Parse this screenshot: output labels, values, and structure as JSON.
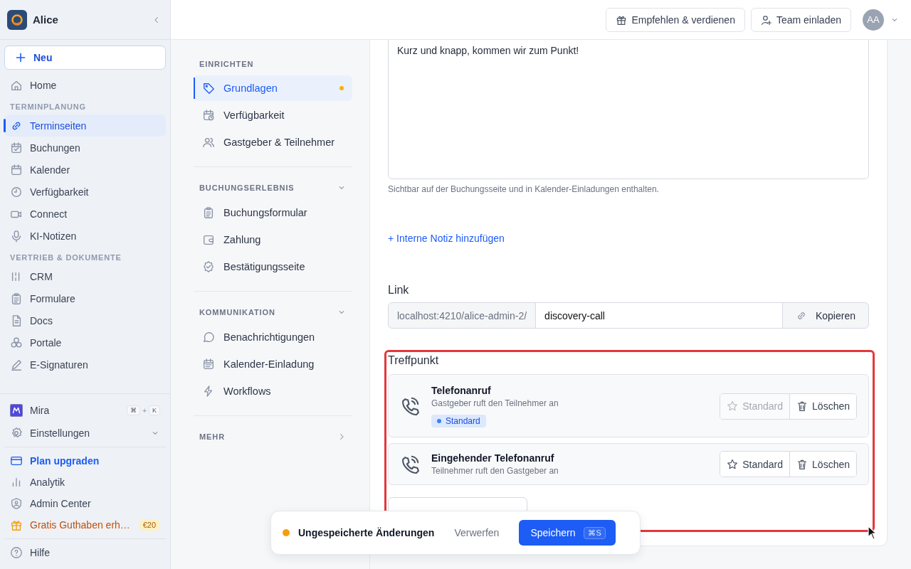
{
  "app": {
    "name": "Alice"
  },
  "new_button": {
    "label": "Neu"
  },
  "sidebar": {
    "sections": [
      {
        "items": [
          {
            "label": "Home",
            "selected": false
          }
        ]
      },
      {
        "heading": "TERMINPLANUNG",
        "items": [
          {
            "label": "Terminseiten",
            "selected": true
          },
          {
            "label": "Buchungen",
            "selected": false
          },
          {
            "label": "Kalender",
            "selected": false
          },
          {
            "label": "Verfügbarkeit",
            "selected": false
          },
          {
            "label": "Connect",
            "selected": false
          },
          {
            "label": "KI-Notizen",
            "selected": false
          }
        ]
      },
      {
        "heading": "VERTRIEB & DOKUMENTE",
        "items": [
          {
            "label": "CRM",
            "selected": false
          },
          {
            "label": "Formulare",
            "selected": false
          },
          {
            "label": "Docs",
            "selected": false
          },
          {
            "label": "Portale",
            "selected": false
          },
          {
            "label": "E-Signaturen",
            "selected": false
          }
        ]
      }
    ]
  },
  "sidebar_footer": {
    "mira": {
      "label": "Mira",
      "keys": [
        "⌘",
        "K"
      ],
      "joiner": "+"
    },
    "settings": {
      "label": "Einstellungen"
    },
    "links": [
      {
        "label": "Plan upgraden",
        "kind": "accent"
      },
      {
        "label": "Analytik",
        "kind": "plain"
      },
      {
        "label": "Admin Center",
        "kind": "plain"
      },
      {
        "label": "Gratis Guthaben erh…",
        "kind": "promo",
        "badge": "€20"
      }
    ],
    "help": {
      "label": "Hilfe"
    }
  },
  "topbar": {
    "buttons": [
      {
        "label": "Empfehlen & verdienen",
        "kind": "gift"
      },
      {
        "label": "Team einladen",
        "kind": "invite"
      }
    ],
    "avatar": "AA"
  },
  "subnav": {
    "sections": [
      {
        "heading": "EINRICHTEN",
        "items": [
          {
            "label": "Grundlagen",
            "selected": true,
            "unsaved": true
          },
          {
            "label": "Verfügbarkeit",
            "selected": false,
            "unsaved": false
          },
          {
            "label": "Gastgeber & Teilnehmer",
            "selected": false,
            "unsaved": false
          }
        ]
      },
      {
        "heading": "BUCHUNGSERLEBNIS",
        "expanded": true,
        "items": [
          {
            "label": "Buchungsformular",
            "selected": false,
            "unsaved": false
          },
          {
            "label": "Zahlung",
            "selected": false,
            "unsaved": false
          },
          {
            "label": "Bestätigungsseite",
            "selected": false,
            "unsaved": false
          }
        ]
      },
      {
        "heading": "KOMMUNIKATION",
        "expanded": true,
        "items": [
          {
            "label": "Benachrichtigungen",
            "selected": false,
            "unsaved": false
          },
          {
            "label": "Kalender-Einladung",
            "selected": false,
            "unsaved": false
          },
          {
            "label": "Workflows",
            "selected": false,
            "unsaved": false
          }
        ]
      },
      {
        "heading": "MEHR",
        "expanded": false
      }
    ]
  },
  "content": {
    "description": {
      "value": "Kurz und knapp, kommen wir zum Punkt!",
      "hint": "Sichtbar auf der Buchungsseite und in Kalender-Einladungen enthalten."
    },
    "add_note": "+ Interne Notiz hinzufügen",
    "link": {
      "label": "Link",
      "prefix": "localhost:4210/alice-admin-2/",
      "slug": "discovery-call",
      "copy": "Kopieren"
    },
    "meeting_point": {
      "label": "Treffpunkt",
      "locations": [
        {
          "title": "Telefonanruf",
          "subtitle": "Gastgeber ruft den Teilnehmer an",
          "default": true,
          "badge": "Standard",
          "set_default": "Standard",
          "delete": "Löschen"
        },
        {
          "title": "Eingehender Telefonanruf",
          "subtitle": "Teilnehmer ruft den Gastgeber an",
          "default": false,
          "set_default": "Standard",
          "delete": "Löschen"
        }
      ]
    }
  },
  "toast": {
    "message": "Ungespeicherte Änderungen",
    "discard": "Verwerfen",
    "save": "Speichern",
    "shortcut": "⌘S"
  }
}
